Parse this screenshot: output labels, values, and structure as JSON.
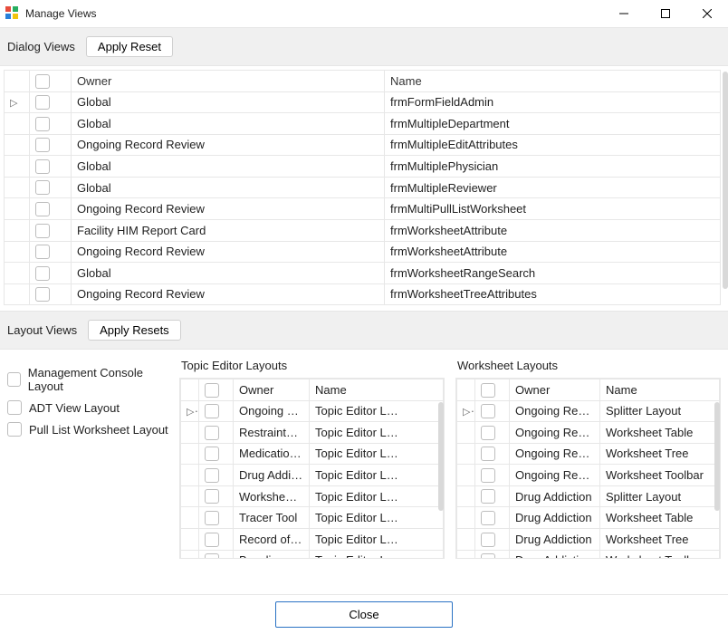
{
  "window": {
    "title": "Manage Views"
  },
  "dialog_views": {
    "label": "Dialog Views",
    "apply_reset_label": "Apply Reset",
    "columns": {
      "owner": "Owner",
      "name": "Name"
    },
    "rows": [
      {
        "owner": "Global",
        "name": "frmFormFieldAdmin"
      },
      {
        "owner": "Global",
        "name": "frmMultipleDepartment"
      },
      {
        "owner": "Ongoing Record Review",
        "name": "frmMultipleEditAttributes"
      },
      {
        "owner": "Global",
        "name": "frmMultiplePhysician"
      },
      {
        "owner": "Global",
        "name": "frmMultipleReviewer"
      },
      {
        "owner": "Ongoing Record Review",
        "name": "frmMultiPullListWorksheet"
      },
      {
        "owner": "Facility HIM Report Card",
        "name": "frmWorksheetAttribute"
      },
      {
        "owner": "Ongoing Record Review",
        "name": "frmWorksheetAttribute"
      },
      {
        "owner": "Global",
        "name": "frmWorksheetRangeSearch"
      },
      {
        "owner": "Ongoing Record Review",
        "name": "frmWorksheetTreeAttributes"
      }
    ]
  },
  "layout_views": {
    "label": "Layout Views",
    "apply_resets_label": "Apply Resets",
    "layout_checks": [
      {
        "label": "Management Console Layout"
      },
      {
        "label": "ADT View Layout"
      },
      {
        "label": "Pull List Worksheet Layout"
      }
    ],
    "topic_editor": {
      "title": "Topic Editor Layouts",
      "columns": {
        "owner": "Owner",
        "name": "Name"
      },
      "rows": [
        {
          "owner": "Ongoing Rec…",
          "name": "Topic Editor L…"
        },
        {
          "owner": "Restraints an…",
          "name": "Topic Editor L…"
        },
        {
          "owner": "Medication M…",
          "name": "Topic Editor L…"
        },
        {
          "owner": "Drug Addiction",
          "name": "Topic Editor L…"
        },
        {
          "owner": "Worksheet-C…",
          "name": "Topic Editor L…"
        },
        {
          "owner": "Tracer Tool",
          "name": "Topic Editor L…"
        },
        {
          "owner": "Record of Care",
          "name": "Topic Editor L…"
        },
        {
          "owner": "Baseline Focu…",
          "name": "Topic Editor L…"
        }
      ]
    },
    "worksheet": {
      "title": "Worksheet Layouts",
      "columns": {
        "owner": "Owner",
        "name": "Name"
      },
      "rows": [
        {
          "owner": "Ongoing Record …",
          "name": "Splitter Layout"
        },
        {
          "owner": "Ongoing Record …",
          "name": "Worksheet Table"
        },
        {
          "owner": "Ongoing Record …",
          "name": "Worksheet Tree"
        },
        {
          "owner": "Ongoing Record …",
          "name": "Worksheet Toolbar"
        },
        {
          "owner": "Drug Addiction",
          "name": "Splitter Layout"
        },
        {
          "owner": "Drug Addiction",
          "name": "Worksheet Table"
        },
        {
          "owner": "Drug Addiction",
          "name": "Worksheet Tree"
        },
        {
          "owner": "Drug Addiction",
          "name": "Worksheet Toolbar"
        }
      ]
    }
  },
  "close_label": "Close"
}
